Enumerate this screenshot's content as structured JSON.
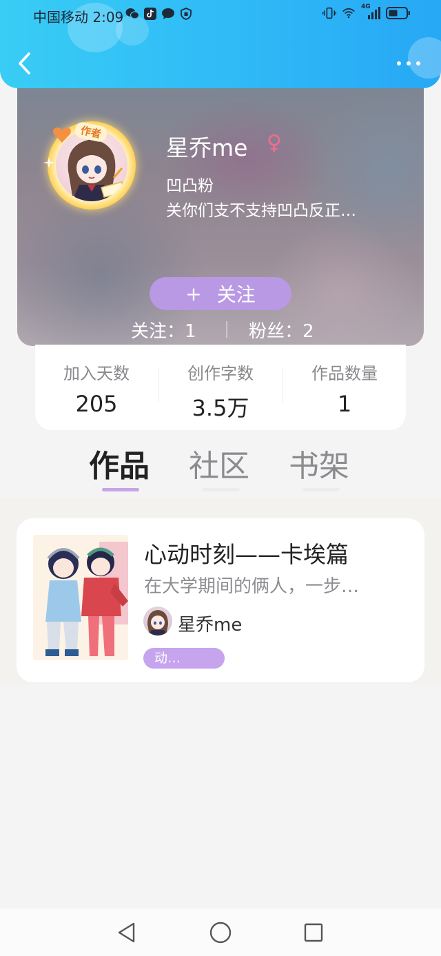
{
  "status_bar": {
    "carrier_time": "中国移动 2:09",
    "left_icons": [
      "wechat-icon",
      "tiktok-icon",
      "message-icon",
      "shield-icon"
    ],
    "right_icons": [
      "vibrate-icon",
      "wifi-icon",
      "signal-icon",
      "battery-icon"
    ],
    "network_label": "4G"
  },
  "header": {
    "back_icon": "chevron-left-icon",
    "more_icon": "more-dots-icon"
  },
  "profile": {
    "name": "星乔me",
    "gender_symbol": "♀",
    "author_badge": "作者",
    "level": "凹凸粉",
    "bio": "关你们支不支持凹凸反正…",
    "follow_button_plus": "+",
    "follow_button_label": "关注",
    "following_text": "关注：1",
    "fans_text": "粉丝：2"
  },
  "stats": [
    {
      "label": "加入天数",
      "value": "205"
    },
    {
      "label": "创作字数",
      "value": "3.5万"
    },
    {
      "label": "作品数量",
      "value": "1"
    }
  ],
  "tabs": [
    {
      "label": "作品",
      "active": true
    },
    {
      "label": "社区",
      "active": false
    },
    {
      "label": "书架",
      "active": false
    }
  ],
  "works": [
    {
      "title": "心动时刻——卡埃篇",
      "description": "在大学期间的俩人，一步…",
      "author": "星乔me",
      "tag": "动…"
    }
  ],
  "colors": {
    "header_gradient_start": "#39cdf5",
    "header_gradient_end": "#27a8f5",
    "follow_button": "#b998e4",
    "tab_active_indicator": "#c6a5e6",
    "tag_background": "#c7a4ee",
    "gender_color": "#f06d8c"
  }
}
